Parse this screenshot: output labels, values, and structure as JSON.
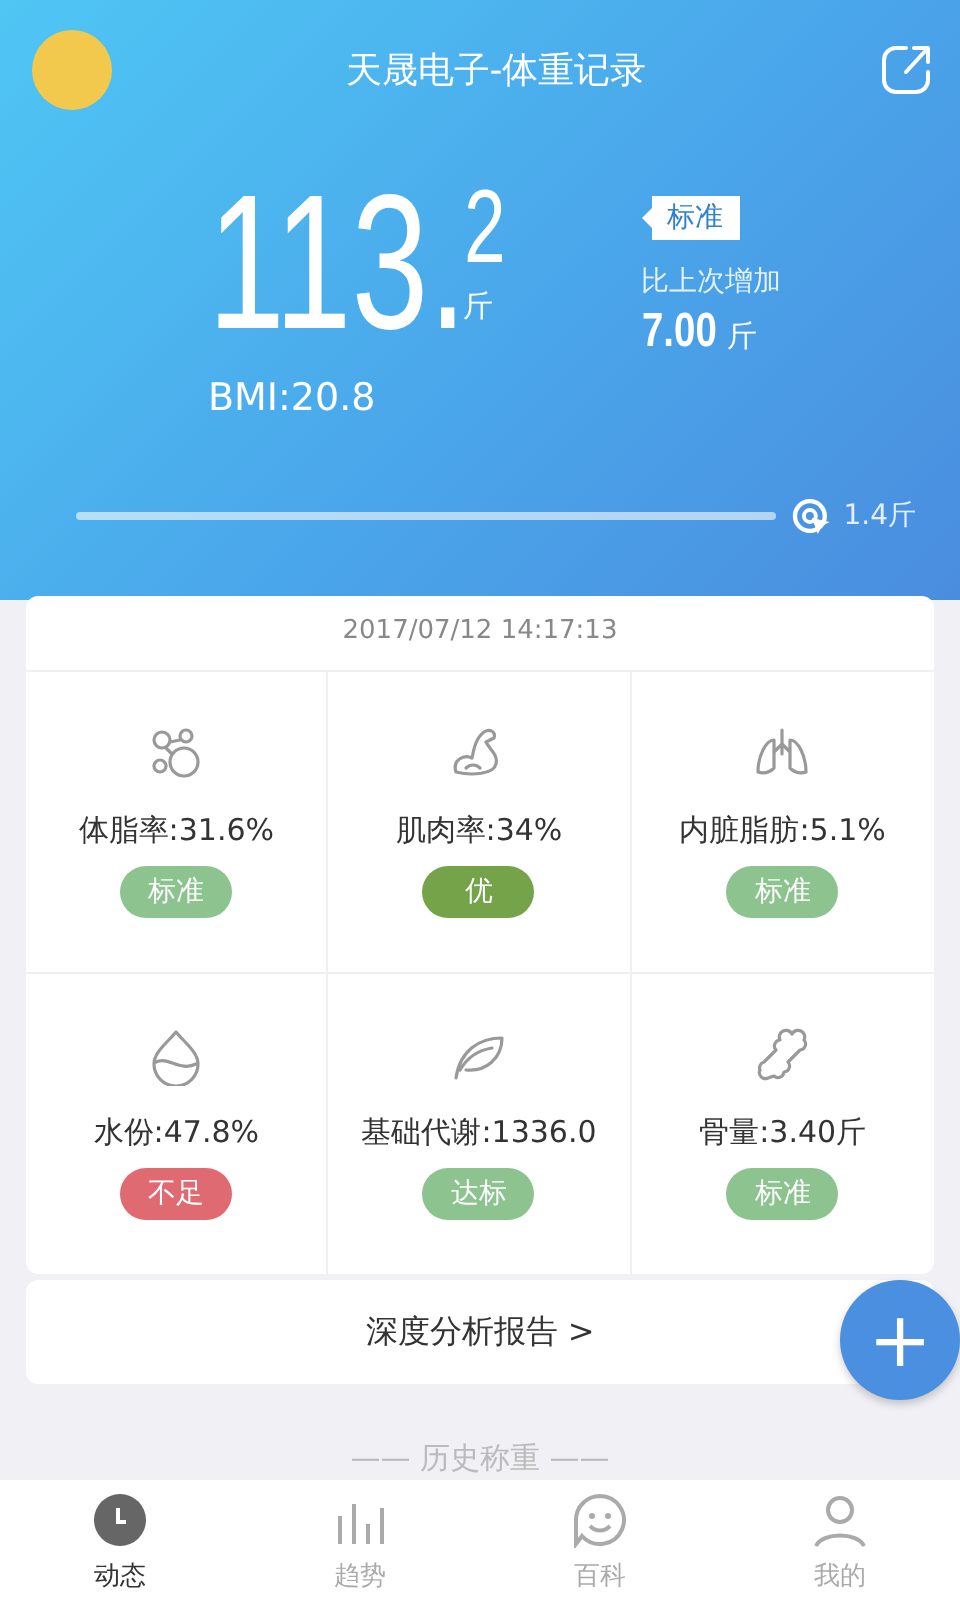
{
  "header": {
    "title": "天晟电子-体重记录",
    "weight_integer": "113.",
    "weight_decimal": "2",
    "weight_unit": "斤",
    "bmi": "BMI:20.8",
    "tag": "标准",
    "change_label": "比上次增加",
    "change_value": "7.00",
    "change_unit": "斤",
    "progress": {
      "level": 1,
      "reading": "1.4斤"
    }
  },
  "measurement": {
    "time": "2017/07/12 14:17:13",
    "metrics": [
      {
        "label": "体脂率:31.6%",
        "badge": "标准",
        "color": "#8cc38f"
      },
      {
        "label": "肌肉率:34%",
        "badge": "优",
        "color": "#74a34a"
      },
      {
        "label": "内脏脂肪:5.1%",
        "badge": "标准",
        "color": "#8cc38f"
      },
      {
        "label": "水份:47.8%",
        "badge": "不足",
        "color": "#e06a72"
      },
      {
        "label": "基础代谢:1336.0",
        "badge": "达标",
        "color": "#8cc38f"
      },
      {
        "label": "骨量:3.40斤",
        "badge": "标准",
        "color": "#8cc38f"
      }
    ]
  },
  "report_link": "深度分析报告 >",
  "fab": "+",
  "history_heading": "—— 历史称重 ——",
  "tabs": [
    {
      "label": "动态",
      "selected": true
    },
    {
      "label": "趋势",
      "selected": false
    },
    {
      "label": "百科",
      "selected": false
    },
    {
      "label": "我的",
      "selected": false
    }
  ]
}
